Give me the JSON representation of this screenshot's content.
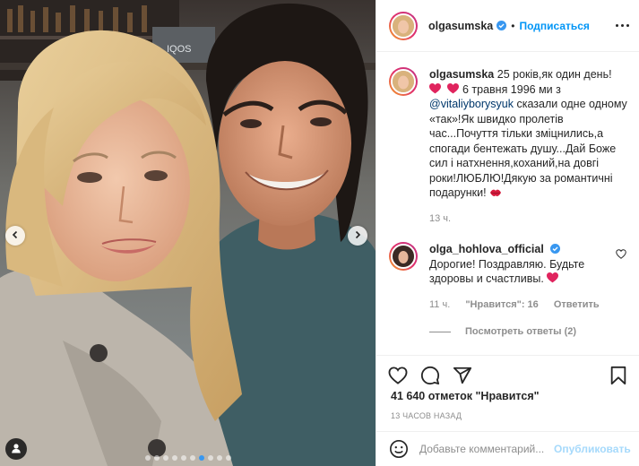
{
  "post": {
    "photo_alt": "",
    "carousel_count": 10,
    "carousel_active": 7
  },
  "header": {
    "username": "olgasumska",
    "separator": "•",
    "follow_label": "Подписаться"
  },
  "caption": {
    "username": "olgasumska",
    "text_line1": "25 років,як один день!",
    "text_line2_after_hearts": "6 травня 1996 ми з",
    "mention": "@vitaliyborysyuk",
    "text_rest": "сказали одне одному «так»!Як швидко пролетів час...Почуття тільки зміцнились,а спогади бентежать душу...Дай Боже сил і натхнення,коханий,на довгі роки!ЛЮБЛЮ!Дякую за романтичні подарунки!",
    "time": "13 ч."
  },
  "comment": {
    "username": "olga_hohlova_official",
    "text": "Дорогие! Поздравляю. Будьте здоровы и счастливы.",
    "time": "11 ч.",
    "likes": "\"Нравится\": 16",
    "reply_label": "Ответить",
    "view_replies": "Посмотреть ответы (2)"
  },
  "stats": {
    "likes": "41 640 отметок \"Нравится\"",
    "date": "13 ЧАСОВ НАЗАД"
  },
  "composer": {
    "placeholder": "Добавьте комментарий...",
    "publish_label": "Опубликовать"
  },
  "colors": {
    "accent": "#0095f6",
    "like_red": "#ed4956",
    "muted": "#8e8e8e",
    "border": "#efefef"
  },
  "icons": [
    "chevron-left-icon",
    "chevron-right-icon",
    "user-tag-icon",
    "verified-badge-icon",
    "more-icon",
    "heart-icon",
    "comment-icon",
    "share-icon",
    "save-icon",
    "emoji-icon",
    "red-heart-emoji",
    "kiss-emoji"
  ]
}
